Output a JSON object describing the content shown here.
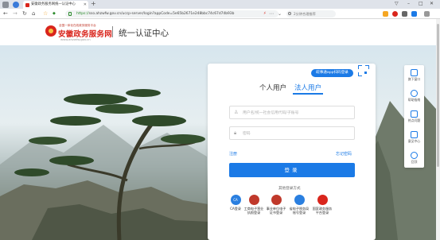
{
  "browser": {
    "tab_title": "安徽政务服务网统一认证中心",
    "new_tab_symbol": "+",
    "url_scheme": "https://",
    "url_rest": "sso.ahzwfw.gov.cn/uccp-server/login?appCode=5e65b2671e248bbc74c67d74b93b",
    "search_text": "2分钟合理推荐",
    "back_symbol": "←",
    "forward_symbol": "→",
    "reload_symbol": "↻",
    "home_symbol": "⌂",
    "star_symbol": "☆",
    "more_symbol": "⋯",
    "chevron_symbol": "⌄",
    "minimize_symbol": "–",
    "maximize_symbol": "□",
    "close_symbol": "✕"
  },
  "header": {
    "logo_sub": "全国一体化在线政务服务平台",
    "logo_name": "安徽政务服务网",
    "logo_url": "www.ahzwfw.gov.cn",
    "title": "统一认证中心"
  },
  "login": {
    "app_login_label": "皖事通app扫码登录",
    "tabs": [
      {
        "label": "个人用户",
        "active": false
      },
      {
        "label": "法人用户",
        "active": true
      }
    ],
    "username_placeholder": "用户名/统一社会信用代码/子账号",
    "password_placeholder": "密码",
    "register_label": "注册",
    "forgot_label": "忘记密码",
    "submit_label": "登录",
    "other_methods_title": "其他登录方式",
    "alt_methods": [
      {
        "icon": "ca-icon",
        "icon_text": "CA",
        "label": "CA登录",
        "color": "#2a7fe0"
      },
      {
        "icon": "business-license-icon",
        "icon_text": "",
        "label": "工商电子营业执照登录",
        "color": "#c0392b"
      },
      {
        "icon": "institution-certificate-icon",
        "icon_text": "",
        "label": "事业单位电子证书登录",
        "color": "#c0392b"
      },
      {
        "icon": "provincial-platform-icon",
        "icon_text": "",
        "label": "省电子税务局账号登录",
        "color": "#2a7fe0"
      },
      {
        "icon": "national-platform-icon",
        "icon_text": "",
        "label": "国家政务服务平台登录",
        "color": "#d9251c"
      }
    ]
  },
  "float_bar": {
    "items": [
      {
        "icon": "hall-icon",
        "label": "旗下窗口"
      },
      {
        "icon": "help-icon",
        "label": "帮助指南"
      },
      {
        "icon": "faq-icon",
        "label": "热点问题"
      },
      {
        "icon": "feedback-icon",
        "label": "意见中心"
      },
      {
        "icon": "top-icon",
        "label": "回顶"
      }
    ]
  },
  "colors": {
    "accent": "#1b7ae6",
    "brand_red": "#d9251c"
  }
}
